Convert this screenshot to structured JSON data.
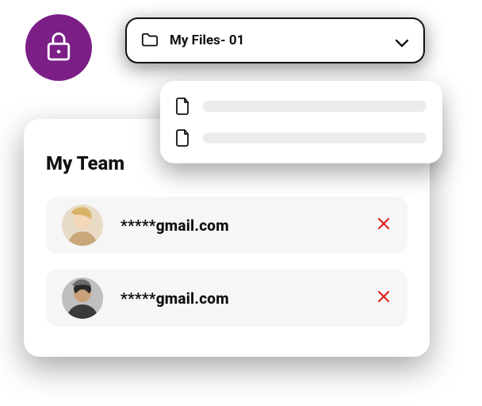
{
  "lock": {
    "icon": "lock-icon",
    "color": "#7b1f87"
  },
  "folderSelect": {
    "icon": "folder-icon",
    "label": "My Files- 01",
    "chevron": "chevron-down-icon"
  },
  "dropdown": {
    "items": [
      {
        "icon": "file-icon"
      },
      {
        "icon": "file-icon"
      }
    ]
  },
  "team": {
    "title": "My Team",
    "members": [
      {
        "avatar": "avatar-1",
        "email": "*****gmail.com",
        "removeIcon": "close-icon"
      },
      {
        "avatar": "avatar-2",
        "email": "*****gmail.com",
        "removeIcon": "close-icon"
      }
    ]
  }
}
